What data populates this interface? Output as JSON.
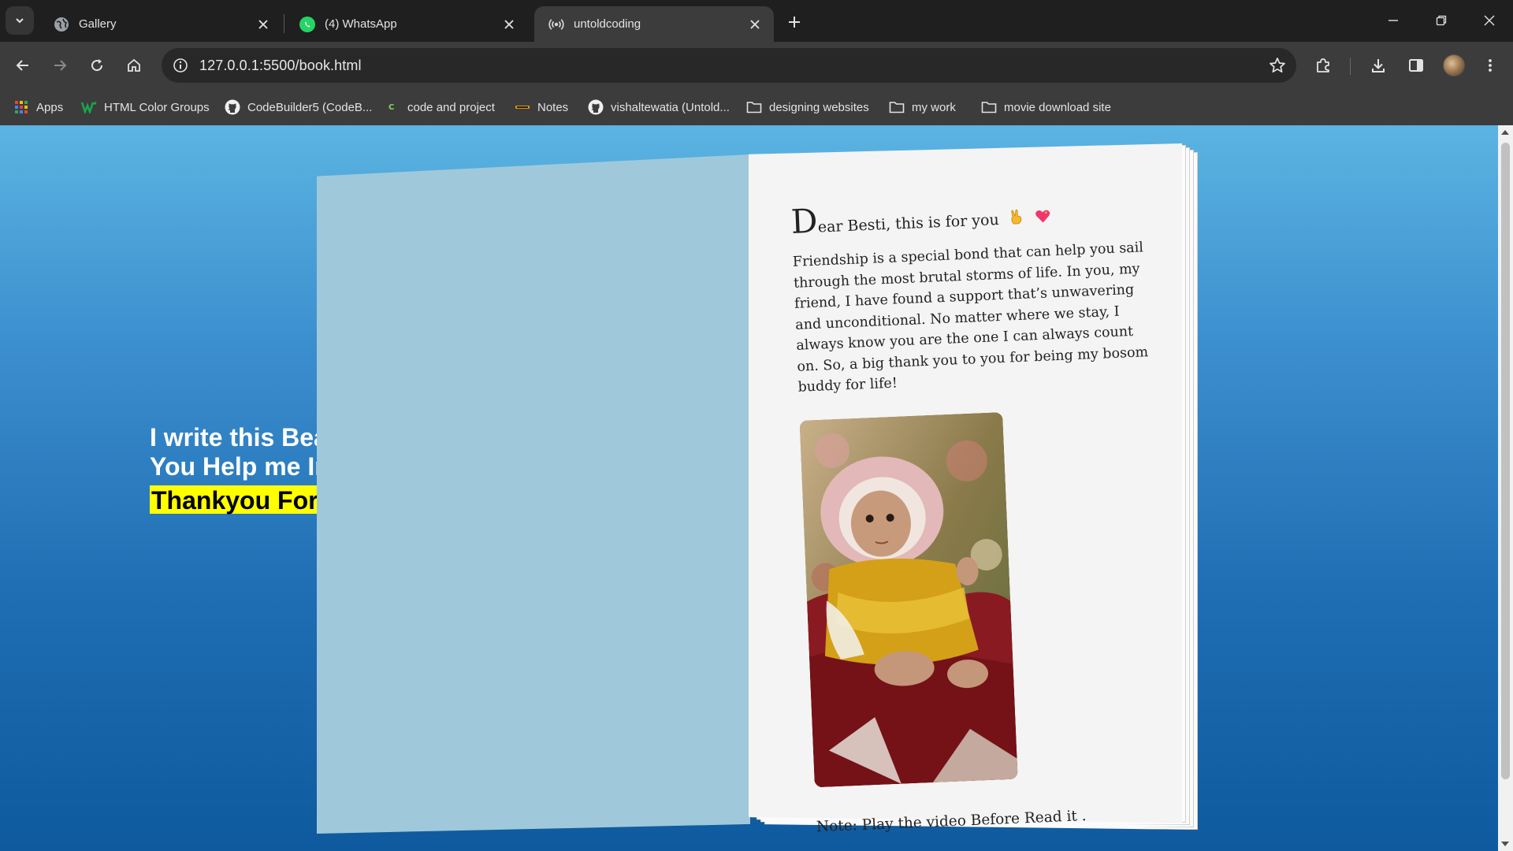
{
  "tabs": [
    {
      "title": "Gallery",
      "icon": "globe-icon"
    },
    {
      "title": "(4) WhatsApp",
      "icon": "whatsapp-icon"
    },
    {
      "title": "untoldcoding",
      "icon": "broadcast-icon",
      "active": true
    }
  ],
  "toolbar": {
    "url": "127.0.0.1:5500/book.html"
  },
  "bookmarks": [
    {
      "label": "Apps",
      "icon": "apps-grid-icon"
    },
    {
      "label": "HTML Color Groups",
      "icon": "w-logo-icon"
    },
    {
      "label": "CodeBuilder5 (CodeB...",
      "icon": "github-icon"
    },
    {
      "label": "code and project",
      "icon": "c-logo-icon"
    },
    {
      "label": "Notes",
      "icon": "notes-icon"
    },
    {
      "label": "vishaltewatia (Untold...",
      "icon": "github-icon"
    },
    {
      "label": "designing websites",
      "icon": "folder-icon"
    },
    {
      "label": "my work",
      "icon": "folder-icon"
    },
    {
      "label": "movie download site",
      "icon": "folder-icon"
    }
  ],
  "page": {
    "side_line1": "I write this Bea",
    "side_line2": "You Help me In",
    "side_highlight": "Thankyou For",
    "book": {
      "dropcap": "D",
      "heading_rest": "ear Besti, this is for you",
      "paragraph": "Friendship is a special bond that can help you sail through the most brutal storms of life. In you, my friend, I have found a support that’s unwavering and unconditional. No matter where we stay, I always know you are the one I can always count on. So, a big thank you to you for being my bosom buddy for life!",
      "note": "Note: Play the video Before Read it ."
    }
  },
  "colors": {
    "highlight": "#ffff00",
    "page_bg_top": "#5bb4e2",
    "page_bg_bottom": "#0f5a9e",
    "left_page": "#9fc9da"
  }
}
